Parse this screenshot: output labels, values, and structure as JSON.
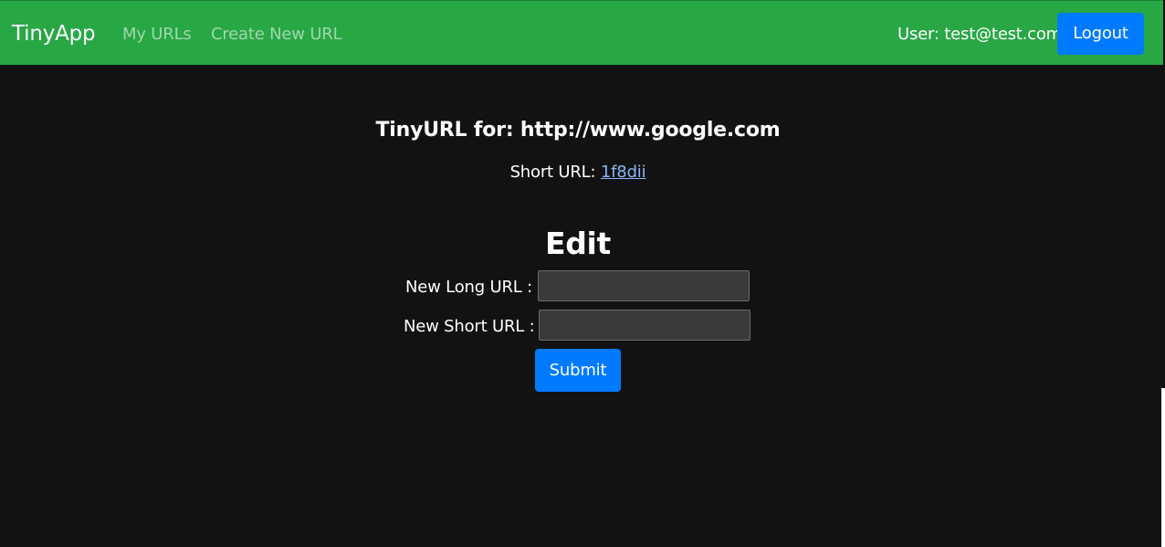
{
  "navbar": {
    "brand": "TinyApp",
    "links": {
      "my_urls": "My URLs",
      "create_new": "Create New URL"
    },
    "user_label": "User: test@test.com",
    "logout_label": "Logout"
  },
  "main": {
    "title": "TinyURL for: http://www.google.com",
    "short_url_prefix": "Short URL:",
    "short_url_value": "1f8dii",
    "edit_heading": "Edit",
    "form": {
      "long_url_label": "New Long URL :",
      "long_url_value": "",
      "short_url_label": "New Short URL :",
      "short_url_value": "",
      "submit_label": "Submit"
    }
  },
  "colors": {
    "navbar_bg": "#28a745",
    "page_bg": "#121212",
    "primary_button": "#007bff",
    "link": "#8ab4f8",
    "input_bg": "#3a3a3a"
  }
}
